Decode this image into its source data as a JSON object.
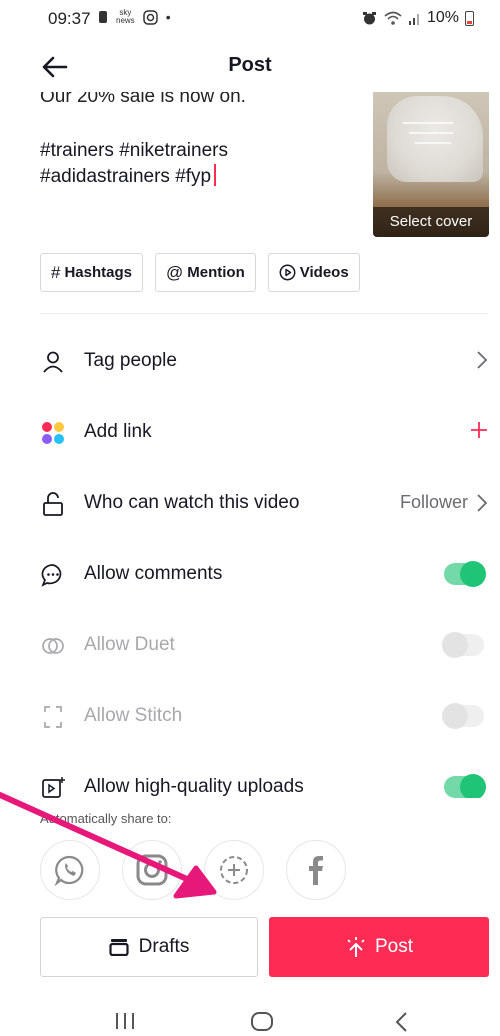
{
  "status_bar": {
    "time": "09:37",
    "battery": "10%",
    "sky_badge": "sky news"
  },
  "header": {
    "title": "Post"
  },
  "caption": {
    "cut_line": "Our 20% sale is now on.",
    "line1": "#trainers #niketrainers",
    "line2": "#adidastrainers #fyp"
  },
  "cover": {
    "label": "Select cover"
  },
  "chips": [
    {
      "symbol": "#",
      "label": "Hashtags"
    },
    {
      "symbol": "@",
      "label": "Mention"
    },
    {
      "symbol": "▷",
      "label": "Videos"
    }
  ],
  "settings": {
    "tag_people": {
      "label": "Tag people"
    },
    "add_link": {
      "label": "Add link"
    },
    "who_can_watch": {
      "label": "Who can watch this video",
      "value": "Follower"
    },
    "allow_comments": {
      "label": "Allow comments",
      "enabled": true
    },
    "allow_duet": {
      "label": "Allow Duet",
      "enabled": false
    },
    "allow_stitch": {
      "label": "Allow Stitch",
      "enabled": false
    },
    "allow_hq_uploads": {
      "label": "Allow high-quality uploads",
      "enabled": true
    }
  },
  "share": {
    "label": "Automatically share to:",
    "targets": [
      "whatsapp-icon",
      "instagram-icon",
      "add-story-icon",
      "facebook-icon"
    ]
  },
  "actions": {
    "drafts_label": "Drafts",
    "post_label": "Post"
  },
  "colors": {
    "accent": "#fe2c55",
    "toggle_on": "#20c476",
    "annotation_arrow": "#e6197a"
  }
}
